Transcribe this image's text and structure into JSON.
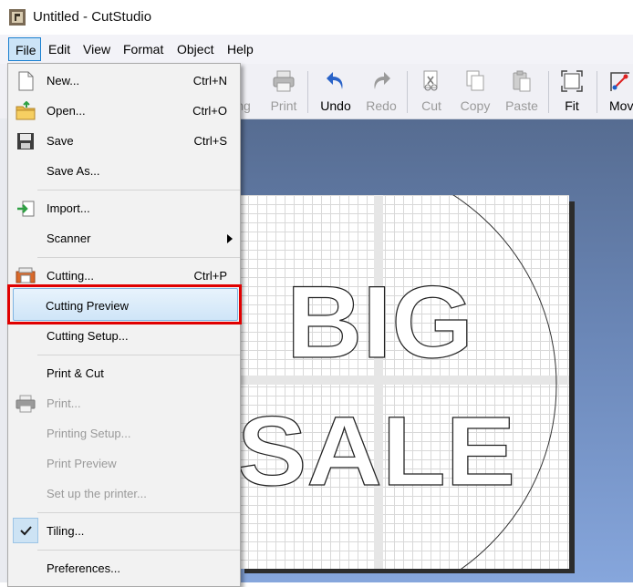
{
  "window": {
    "title": "Untitled - CutStudio"
  },
  "menubar": [
    "File",
    "Edit",
    "View",
    "Format",
    "Object",
    "Help"
  ],
  "toolbar": [
    {
      "label": "ng",
      "icon": "print-and-cut-icon",
      "enabled": true
    },
    {
      "label": "Print",
      "icon": "printer-icon",
      "enabled": false
    },
    {
      "label": "Undo",
      "icon": "undo-icon",
      "enabled": true
    },
    {
      "label": "Redo",
      "icon": "redo-icon",
      "enabled": false
    },
    {
      "label": "Cut",
      "icon": "cut-icon",
      "enabled": false
    },
    {
      "label": "Copy",
      "icon": "copy-icon",
      "enabled": false
    },
    {
      "label": "Paste",
      "icon": "paste-icon",
      "enabled": false
    },
    {
      "label": "Fit",
      "icon": "fit-icon",
      "enabled": true
    },
    {
      "label": "Mov",
      "icon": "move-icon",
      "enabled": true
    }
  ],
  "file_menu": [
    {
      "label": "New...",
      "shortcut": "Ctrl+N",
      "icon": "new-document-icon"
    },
    {
      "label": "Open...",
      "shortcut": "Ctrl+O",
      "icon": "open-folder-icon"
    },
    {
      "label": "Save",
      "shortcut": "Ctrl+S",
      "icon": "save-disk-icon"
    },
    {
      "label": "Save As...",
      "shortcut": ""
    },
    {
      "label": "Import...",
      "shortcut": "",
      "icon": "import-icon"
    },
    {
      "label": "Scanner",
      "shortcut": "",
      "submenu": true
    },
    {
      "label": "Cutting...",
      "shortcut": "Ctrl+P",
      "icon": "cutting-icon"
    },
    {
      "label": "Cutting Preview",
      "shortcut": "",
      "highlighted": true
    },
    {
      "label": "Cutting Setup...",
      "shortcut": ""
    },
    {
      "label": "Print & Cut",
      "shortcut": ""
    },
    {
      "label": "Print...",
      "shortcut": "",
      "disabled": true,
      "icon": "print-icon"
    },
    {
      "label": "Printing Setup...",
      "shortcut": "",
      "disabled": true
    },
    {
      "label": "Print Preview",
      "shortcut": "",
      "disabled": true
    },
    {
      "label": "Set up the printer...",
      "shortcut": "",
      "disabled": true
    },
    {
      "label": "Tiling...",
      "shortcut": "",
      "checked": true
    },
    {
      "label": "Preferences...",
      "shortcut": ""
    }
  ],
  "canvas": {
    "text_line1": "BIG",
    "text_line2": "SALE"
  },
  "colors": {
    "highlight_box": "#e00000",
    "accent": "#1a7fd0"
  }
}
